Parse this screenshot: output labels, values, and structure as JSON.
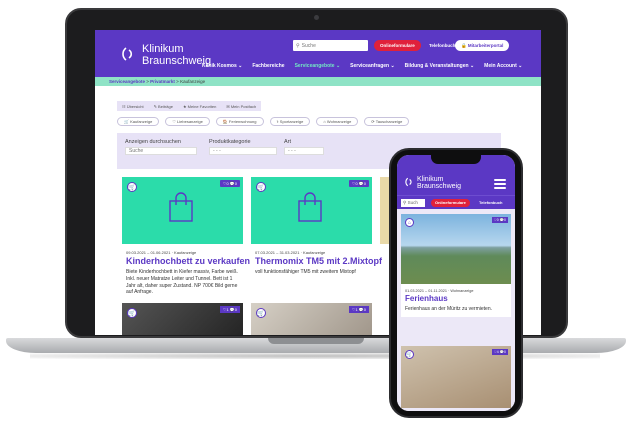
{
  "desktop": {
    "logo": {
      "line1": "Klinikum",
      "line2": "Braunschweig"
    },
    "search_placeholder": "Suche",
    "btn_onlineformulare": "Onlineformulare",
    "link_telefonbuch": "Telefonbuch",
    "btn_mitarbeiter": "Mitarbeiterportal",
    "nav": [
      "Klinik Kosmos ⌄",
      "Fachbereiche",
      "Serviceangebote ⌄",
      "Serviceanfragen ⌄",
      "Bildung & Veranstaltungen ⌄",
      "Mein Account ⌄"
    ],
    "breadcrumb": {
      "a": "Serviceangebote",
      "b": "Privatmarkt",
      "c": "Kaufanzeige"
    },
    "tabs": [
      "☷ Übersicht",
      "✎ Beiträge",
      "★ Meine Favoriten",
      "✉ Mein Postfach"
    ],
    "chips": [
      "🛒 Kaufanzeige",
      "♡ Liebesanzeige",
      "🏠 Ferienwohnung",
      "⚕ Sportanzeige",
      "⌂ Wohnanzeige",
      "⟳ Tauschanzeige"
    ],
    "filter": {
      "search_label": "Anzeigen durchsuchen",
      "search_placeholder": "Suche",
      "category_label": "Produktkategorie",
      "category_value": "- - -",
      "type_label": "Art",
      "type_value": "- - -"
    },
    "cards": [
      {
        "badge": "♡0 💬0",
        "meta": "09.03.2021 – 01.06.2021 · Kaufanzeige",
        "title": "Kinderhochbett zu verkaufen",
        "desc": "Biete Kinderhochbett in Kiefer massiv, Farbe weiß. Inkl. neuer Matratze Leiter und Tunnel. Bett ist 1 Jahr alt, daher super Zustand. NP 700€ Bild gerne auf Anfrage."
      },
      {
        "badge": "♡0 💬0",
        "meta": "07.03.2021 – 31.03.2021 · Kaufanzeige",
        "title": "Thermomix TM5 mit 2.Mixtopf",
        "desc": "voll funktionsfähiger TM5 mit zweitem Mixtopf"
      }
    ],
    "card_row2_badges": [
      "♡1 💬0",
      "♡1 💬0"
    ]
  },
  "phone": {
    "logo": {
      "line1": "Klinikum",
      "line2": "Braunschweig"
    },
    "search_placeholder": "Such",
    "btn_onlineformulare": "Onlineformulare",
    "link_telefonbuch": "Telefonbuch",
    "card": {
      "badge": "♡0 💬0",
      "meta": "01.03.2021 – 01.11.2021 · Wohnanzeige",
      "title": "Ferienhaus",
      "desc": "Ferienhaus an der Müritz zu vermieten."
    },
    "card2_badge": "♡4 💬0"
  },
  "colors": {
    "brand": "#5b38c4",
    "accent": "#2bdcaa",
    "breadcrumb_bg": "#8fe3c6",
    "red": "#e0213b",
    "panel": "#e7e2f6"
  }
}
